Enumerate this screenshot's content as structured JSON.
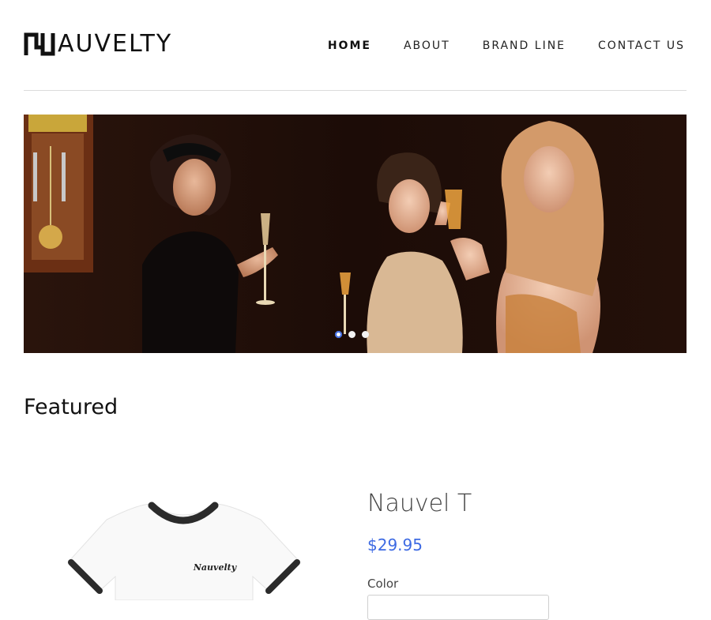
{
  "brand": {
    "name": "AUVELTY"
  },
  "nav": {
    "items": [
      "HOME",
      "ABOUT",
      "BRAND LINE",
      "CONTACT US"
    ],
    "active_index": 0
  },
  "hero": {
    "slide_count": 3,
    "active_slide": 0
  },
  "featured": {
    "title": "Featured"
  },
  "product": {
    "name": "Nauvel T",
    "price": "$29.95",
    "color_label": "Color",
    "shirt_print": "Nauvelty"
  },
  "colors": {
    "accent": "#3d6ae3",
    "text": "#111111",
    "divider": "#dcdcdc"
  }
}
